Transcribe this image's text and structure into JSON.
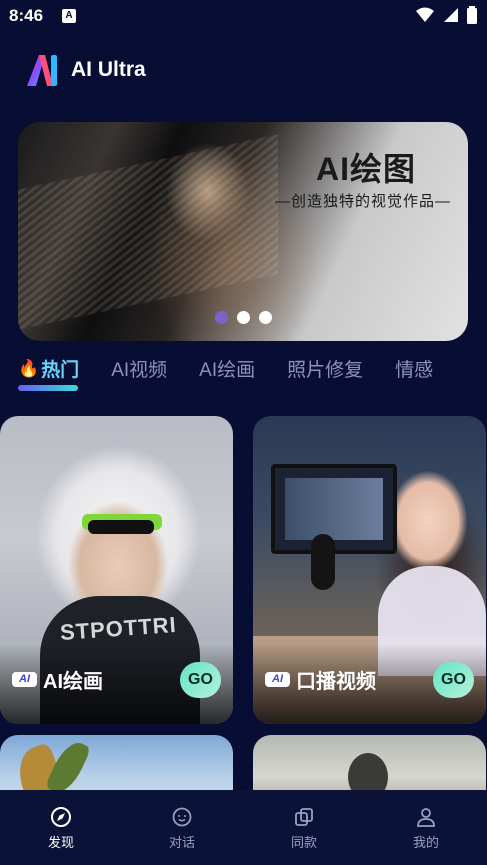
{
  "status_bar": {
    "time": "8:46",
    "notification_badge": "A"
  },
  "header": {
    "app_title": "AI Ultra"
  },
  "banner": {
    "title": "AI绘图",
    "subtitle": "—创造独特的视觉作品—",
    "page_count": 3,
    "active_page": 0
  },
  "tabs": [
    {
      "label": "热门",
      "active": true,
      "icon": "fire-icon"
    },
    {
      "label": "AI视频"
    },
    {
      "label": "AI绘画"
    },
    {
      "label": "照片修复"
    },
    {
      "label": "情感"
    }
  ],
  "cards": [
    {
      "badge": "AI",
      "label": "AI绘画",
      "go": "GO"
    },
    {
      "badge": "AI",
      "label": "口播视频",
      "go": "GO"
    }
  ],
  "shirt_text": "STPOTTRI",
  "bottom_nav": [
    {
      "label": "发现",
      "icon": "compass-icon",
      "active": true
    },
    {
      "label": "对话",
      "icon": "chat-icon"
    },
    {
      "label": "同款",
      "icon": "copy-icon"
    },
    {
      "label": "我的",
      "icon": "user-icon"
    }
  ],
  "colors": {
    "background": "#070d33",
    "accent": "#6bd3ff",
    "go_button": "#63e5c3",
    "dot_active": "#7c63c9"
  }
}
